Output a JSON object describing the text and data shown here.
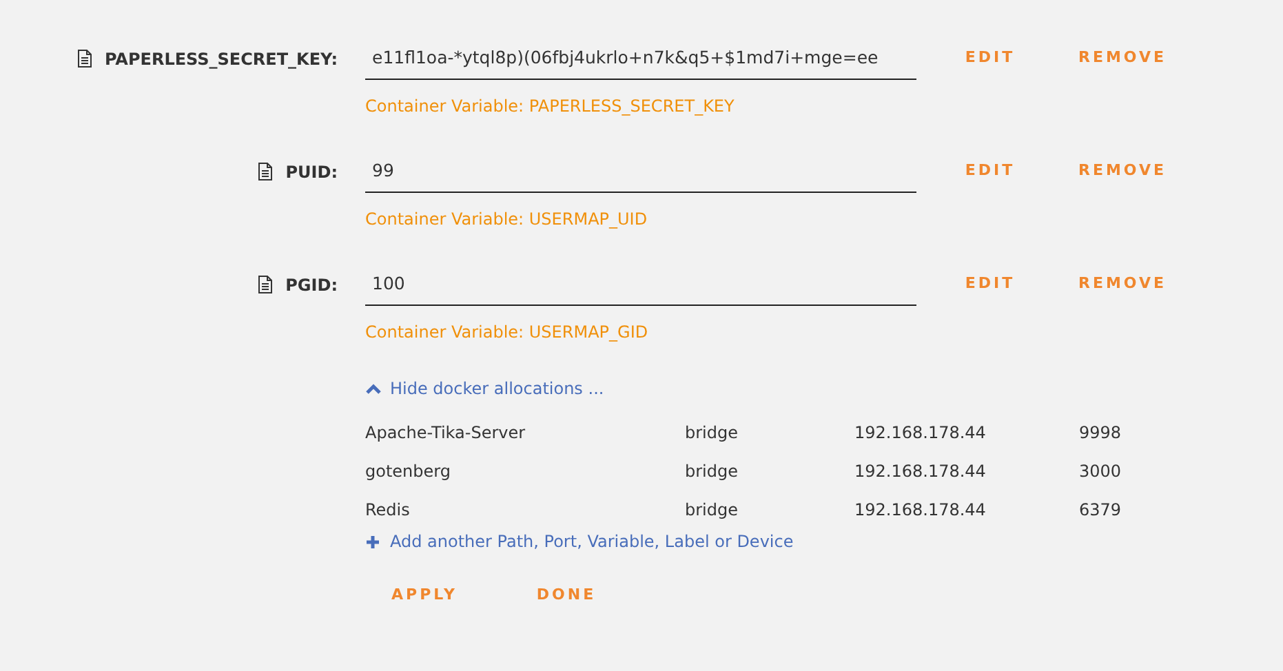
{
  "variables": [
    {
      "label": "PAPERLESS_SECRET_KEY:",
      "value": "e11fl1oa-*ytql8p)(06fbj4ukrlo+n7k&q5+$1md7i+mge=ee",
      "hint": "Container Variable: PAPERLESS_SECRET_KEY",
      "buttons": [
        "EDIT",
        "REMOVE"
      ]
    },
    {
      "label": "PUID:",
      "value": "99",
      "hint": "Container Variable: USERMAP_UID",
      "buttons": [
        "EDIT",
        "REMOVE"
      ]
    },
    {
      "label": "PGID:",
      "value": "100",
      "hint": "Container Variable: USERMAP_GID",
      "buttons": [
        "EDIT",
        "REMOVE"
      ]
    }
  ],
  "allocations_toggle": {
    "label": "Hide docker allocations ...",
    "expanded": true
  },
  "allocations": [
    {
      "name": "Apache-Tika-Server",
      "network": "bridge",
      "ip": "192.168.178.44",
      "port": "9998"
    },
    {
      "name": "gotenberg",
      "network": "bridge",
      "ip": "192.168.178.44",
      "port": "3000"
    },
    {
      "name": "Redis",
      "network": "bridge",
      "ip": "192.168.178.44",
      "port": "6379"
    }
  ],
  "add_link": "Add another Path, Port, Variable, Label or Device",
  "actions": [
    "APPLY",
    "DONE"
  ]
}
